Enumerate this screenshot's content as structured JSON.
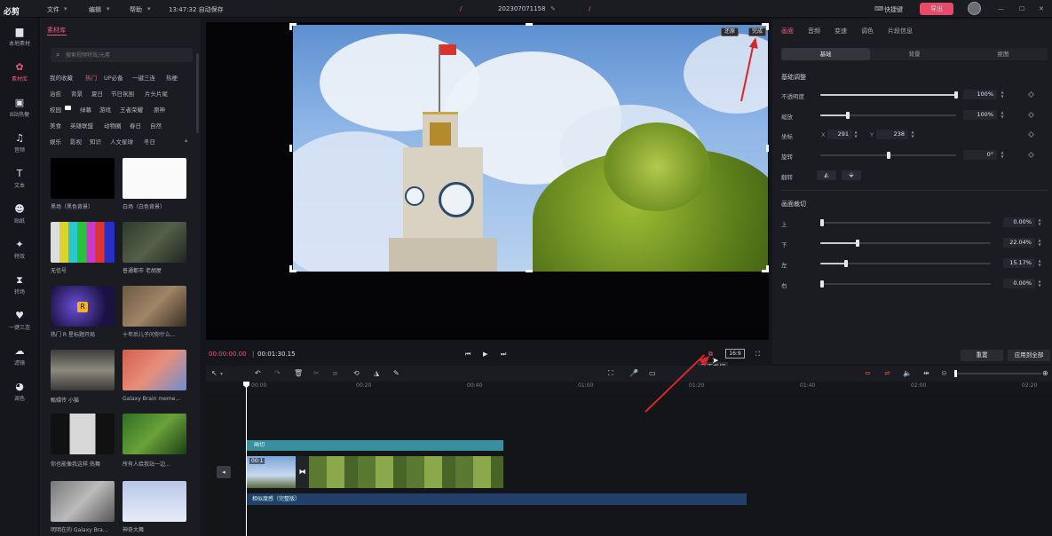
{
  "topbar": {
    "logo": "必剪",
    "menu": [
      "文件",
      "编辑",
      "帮助"
    ],
    "autosave": "13:47:32 自动保存",
    "project_name": "202307071158",
    "shortcut": "快捷键",
    "export": "导出"
  },
  "leftnav": {
    "items": [
      {
        "label": "本地素材",
        "icon": "folder-icon"
      },
      {
        "label": "素材库",
        "icon": "material-icon"
      },
      {
        "label": "B站热梗",
        "icon": "bilibili-icon"
      },
      {
        "label": "音频",
        "icon": "music-icon"
      },
      {
        "label": "文本",
        "icon": "text-icon"
      },
      {
        "label": "贴纸",
        "icon": "sticker-icon"
      },
      {
        "label": "特效",
        "icon": "effects-icon"
      },
      {
        "label": "转场",
        "icon": "transition-icon"
      },
      {
        "label": "一键三连",
        "icon": "like-icon"
      },
      {
        "label": "滤镜",
        "icon": "filter-icon"
      },
      {
        "label": "调色",
        "icon": "palette-icon"
      }
    ]
  },
  "material": {
    "tab": "素材库",
    "search_placeholder": "搜索视频特效/元素",
    "tags": [
      [
        "我的收藏",
        "热门",
        "UP必备",
        "一键三连",
        "热梗"
      ],
      [
        "治愈",
        "背景",
        "夏日",
        "节日氛围",
        "片头片尾"
      ],
      [
        "校园",
        "绿幕",
        "游戏",
        "王者荣耀",
        "原神"
      ],
      [
        "美食",
        "英雄联盟",
        "动物圈",
        "春日",
        "自然"
      ],
      [
        "娱乐",
        "影视",
        "知识",
        "人文星球",
        "冬日"
      ]
    ],
    "cards": [
      {
        "caption": "黑场（黑色背景）"
      },
      {
        "caption": "白场（白色背景）"
      },
      {
        "caption": "无信号"
      },
      {
        "caption": "普通都市 老胡屋"
      },
      {
        "caption": "热门 R 星标题开局"
      },
      {
        "caption": "十年后儿子问你什么..."
      },
      {
        "caption": "甄嬛传 小猫"
      },
      {
        "caption": "Galaxy Brain meme..."
      },
      {
        "caption": "你也能像我这样 热舞"
      },
      {
        "caption": "所有人给我站一边..."
      },
      {
        "caption": "明明在的 Galaxy Bra..."
      },
      {
        "caption": "神奇大舞"
      }
    ]
  },
  "preview": {
    "restore": "还原",
    "done": "完成",
    "time_current": "00:00:00.00",
    "time_total": "00:01:30.15",
    "ratio": "16:9",
    "tooltip": "画面裁切"
  },
  "rightpanel": {
    "tabs": [
      "画面",
      "音频",
      "变速",
      "调色",
      "片段信息"
    ],
    "subtabs": [
      "基础",
      "背景",
      "抠图"
    ],
    "basic_title": "基础调整",
    "opacity_label": "不透明度",
    "opacity_value": "100%",
    "opacity": 1.0,
    "scale_label": "缩放",
    "scale_value": "100%",
    "scale": 0.2,
    "position_label": "坐标",
    "pos_x": "291",
    "pos_y": "238",
    "rotate_label": "旋转",
    "rotate_value": "0°",
    "rotate": 0.5,
    "flip_label": "翻转",
    "crop_title": "画面裁切",
    "crop": [
      {
        "label": "上",
        "value": "0.00%",
        "level": 0.0
      },
      {
        "label": "下",
        "value": "22.04%",
        "level": 0.22
      },
      {
        "label": "左",
        "value": "15.17%",
        "level": 0.15
      },
      {
        "label": "右",
        "value": "0.00%",
        "level": 0.0
      }
    ],
    "reset": "重置",
    "apply_all": "应用到全部"
  },
  "timeline": {
    "ticks": [
      "00:00",
      "00:20",
      "00:40",
      "01:00",
      "01:20",
      "01:40",
      "02:00",
      "02:20"
    ],
    "clip_label": "画切",
    "clip_time": "00:1",
    "audio_label": "相似度感（完整版）"
  }
}
